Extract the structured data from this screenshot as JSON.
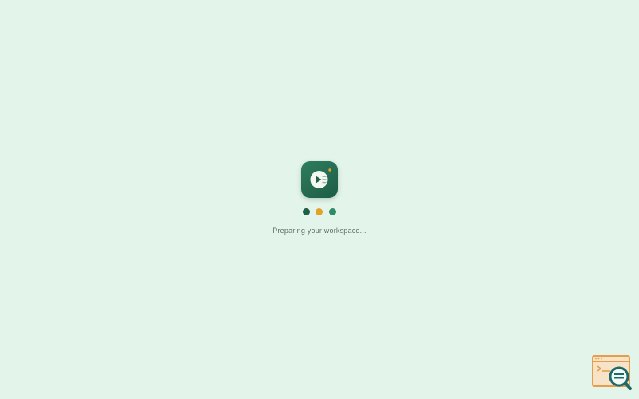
{
  "loader": {
    "status_text": "Preparing your workspace...",
    "logo_icon": "play-list-icon",
    "dots": [
      {
        "color": "#1f5e47"
      },
      {
        "color": "#e0a326"
      },
      {
        "color": "#2f8a66"
      }
    ]
  },
  "corner_badge": {
    "icon": "search-window-icon"
  },
  "colors": {
    "background": "#e3f4ea",
    "brand_dark": "#1d5c45",
    "brand_light": "#2f7d5f",
    "accent": "#e0a326",
    "text_muted": "#5f6f67"
  }
}
